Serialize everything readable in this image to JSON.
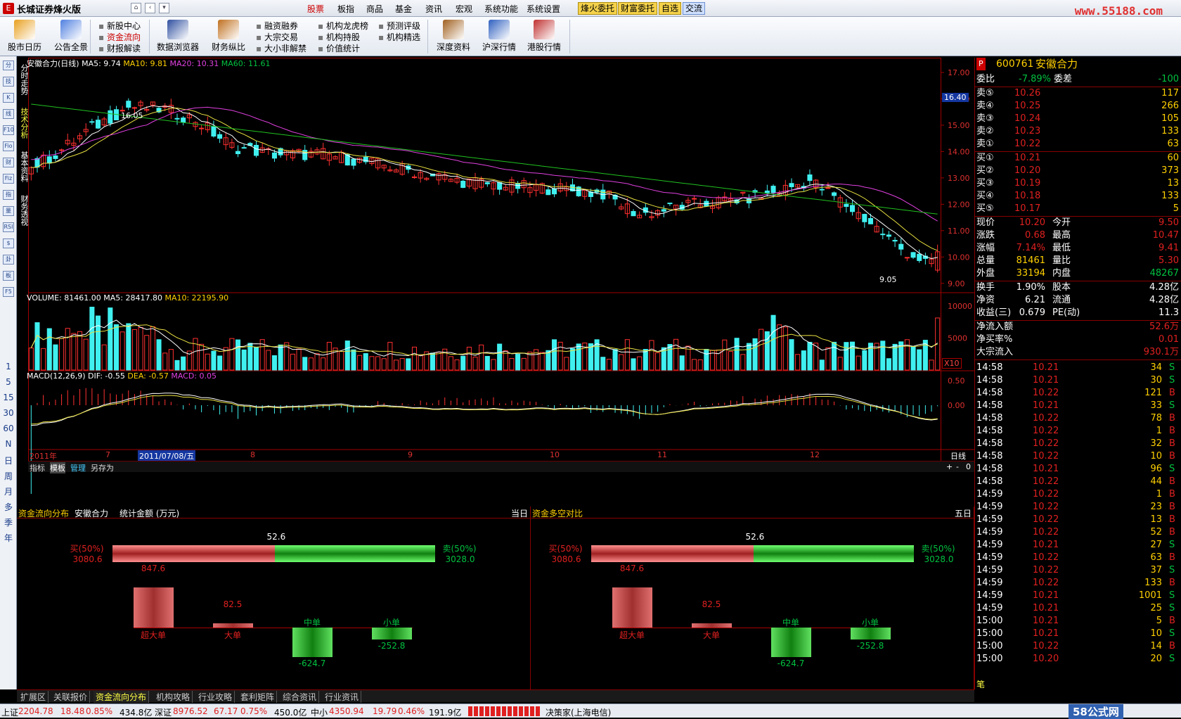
{
  "titlebar": {
    "app": "长城证券烽火版",
    "logo": "E",
    "menus": [
      "股票",
      "板指",
      "商品",
      "基金",
      "资讯",
      "宏观",
      "系统功能",
      "系统设置"
    ],
    "active_menu": "股票",
    "highlights": [
      "烽火委托",
      "财富委托",
      "自选",
      "交流"
    ],
    "site": "www.55188.com"
  },
  "toolbar": {
    "big": [
      "股市日历",
      "公告全景",
      "数据浏览器",
      "财务纵比",
      "深度资料",
      "沪深行情",
      "港股行情"
    ],
    "small_col1": [
      "新股中心",
      "资金流向",
      "财报解读"
    ],
    "small_col2": [
      "融资融券",
      "大宗交易",
      "大小非解禁"
    ],
    "small_col3": [
      "机构龙虎榜",
      "机构持股",
      "价值统计"
    ],
    "small_col4": [
      "预测评级",
      "机构精选"
    ]
  },
  "leftbar": {
    "icons": [
      "分",
      "技",
      "K",
      "线",
      "F10",
      "Fio",
      "财",
      "Fiz",
      "指",
      "量",
      "RSI",
      "$",
      "卦",
      "板",
      "F5"
    ],
    "periods": [
      "1",
      "5",
      "15",
      "30",
      "60",
      "N",
      "日",
      "周",
      "月",
      "多",
      "季",
      "年"
    ]
  },
  "vtabs": [
    "分时走势",
    "技术分析",
    "基本资料",
    "财务透视"
  ],
  "chart_header": {
    "name": "安徽合力(日线)",
    "ma5": "MA5: 9.74",
    "ma10": "MA10: 9.81",
    "ma20": "MA20: 10.31",
    "ma60": "MA60: 11.61",
    "peak": "16.05",
    "low": "9.05",
    "cur_price": "16.40"
  },
  "volume_header": {
    "vol": "VOLUME: 81461.00",
    "ma5": "MA5: 28417.80",
    "ma10": "MA10: 22195.90",
    "x10": "X10"
  },
  "macd_header": {
    "macd": "MACD(12,26,9)",
    "dif": "DIF: -0.55",
    "dea": "DEA: -0.57",
    "val": "MACD: 0.05"
  },
  "price_ticks": [
    "17.00",
    "16.00",
    "15.00",
    "14.00",
    "13.00",
    "12.00",
    "11.00",
    "10.00",
    "9.00"
  ],
  "vol_ticks": [
    "10000",
    "5000"
  ],
  "macd_ticks": [
    "0.50",
    "0.00"
  ],
  "date_axis": {
    "year": "2011年",
    "months": [
      "7",
      "8",
      "9",
      "10",
      "11",
      "12"
    ],
    "cursor": "2011/07/08/五",
    "period": "日线"
  },
  "chart_tabs": [
    "指标",
    "模板",
    "管理",
    "另存为"
  ],
  "right": {
    "code": "600761",
    "name": "安徽合力",
    "flag": "P",
    "weibi": {
      "label": "委比",
      "val": "-7.89%",
      "label2": "委差",
      "val2": "-100"
    },
    "sell": [
      [
        "卖⑤",
        "10.26",
        "117"
      ],
      [
        "卖④",
        "10.25",
        "266"
      ],
      [
        "卖③",
        "10.24",
        "105"
      ],
      [
        "卖②",
        "10.23",
        "133"
      ],
      [
        "卖①",
        "10.22",
        "63"
      ]
    ],
    "buy": [
      [
        "买①",
        "10.21",
        "60"
      ],
      [
        "买②",
        "10.20",
        "373"
      ],
      [
        "买③",
        "10.19",
        "13"
      ],
      [
        "买④",
        "10.18",
        "133"
      ],
      [
        "买⑤",
        "10.17",
        "5"
      ]
    ],
    "quote": [
      [
        "现价",
        "10.20",
        "今开",
        "9.50"
      ],
      [
        "涨跌",
        "0.68",
        "最高",
        "10.47"
      ],
      [
        "涨幅",
        "7.14%",
        "最低",
        "9.41"
      ],
      [
        "总量",
        "81461",
        "量比",
        "5.30"
      ],
      [
        "外盘",
        "33194",
        "内盘",
        "48267"
      ]
    ],
    "fund": [
      [
        "换手",
        "1.90%",
        "股本",
        "4.28亿"
      ],
      [
        "净资",
        "6.21",
        "流通",
        "4.28亿"
      ],
      [
        "收益(三)",
        "0.679",
        "PE(动)",
        "11.3"
      ]
    ],
    "flow": [
      [
        "净流入额",
        "52.6万"
      ],
      [
        "净买率%",
        "0.01"
      ],
      [
        "大宗流入",
        "930.1万"
      ]
    ],
    "ticks": [
      [
        "14:58",
        "10.21",
        "34",
        "S"
      ],
      [
        "14:58",
        "10.21",
        "30",
        "S"
      ],
      [
        "14:58",
        "10.22",
        "121",
        "B"
      ],
      [
        "14:58",
        "10.21",
        "33",
        "S"
      ],
      [
        "14:58",
        "10.22",
        "78",
        "B"
      ],
      [
        "14:58",
        "10.22",
        "1",
        "B"
      ],
      [
        "14:58",
        "10.22",
        "32",
        "B"
      ],
      [
        "14:58",
        "10.22",
        "10",
        "B"
      ],
      [
        "14:58",
        "10.21",
        "96",
        "S"
      ],
      [
        "14:58",
        "10.22",
        "44",
        "B"
      ],
      [
        "14:59",
        "10.22",
        "1",
        "B"
      ],
      [
        "14:59",
        "10.22",
        "23",
        "B"
      ],
      [
        "14:59",
        "10.22",
        "13",
        "B"
      ],
      [
        "14:59",
        "10.22",
        "52",
        "B"
      ],
      [
        "14:59",
        "10.21",
        "27",
        "S"
      ],
      [
        "14:59",
        "10.22",
        "63",
        "B"
      ],
      [
        "14:59",
        "10.22",
        "37",
        "S"
      ],
      [
        "14:59",
        "10.22",
        "133",
        "B"
      ],
      [
        "14:59",
        "10.21",
        "1001",
        "S"
      ],
      [
        "14:59",
        "10.21",
        "25",
        "S"
      ],
      [
        "15:00",
        "10.21",
        "5",
        "B"
      ],
      [
        "15:00",
        "10.21",
        "10",
        "S"
      ],
      [
        "15:00",
        "10.22",
        "14",
        "B"
      ],
      [
        "15:00",
        "10.20",
        "20",
        "S"
      ]
    ],
    "bottom_tab": "笔"
  },
  "bottom": {
    "left": {
      "tab": "资金流向分布",
      "stock": "安徽合力",
      "unit": "统计金额 (万元)",
      "range": "当日"
    },
    "right": {
      "tab": "资金多空对比",
      "range": "五日"
    },
    "net": "52.6",
    "buy_label": "买(50%)",
    "buy_val": "3080.6",
    "sell_label": "卖(50%)",
    "sell_val": "3028.0",
    "buy_frac": 0.504,
    "bars": [
      {
        "name": "超大单",
        "val": "847.6",
        "n": 847.6
      },
      {
        "name": "大单",
        "val": "82.5",
        "n": 82.5
      },
      {
        "name": "中单",
        "val": "-624.7",
        "n": -624.7
      },
      {
        "name": "小单",
        "val": "-252.8",
        "n": -252.8
      }
    ]
  },
  "bottom_tabs": [
    "扩展区",
    "关联报价",
    "资金流向分布",
    "机构攻略",
    "行业攻略",
    "套利矩阵",
    "综合资讯",
    "行业资讯"
  ],
  "bottom_active": "资金流向分布",
  "status": {
    "sh": "上证",
    "sh_idx": "2204.78",
    "sh_chg": "18.48",
    "sh_pct": "0.85%",
    "sh_amt": "434.8亿",
    "sz": "深证",
    "sz_idx": "8976.52",
    "sz_chg": "67.17",
    "sz_pct": "0.75%",
    "sz_amt": "450.0亿",
    "zx": "中小",
    "zx_idx": "4350.94",
    "zx_chg": "19.79",
    "zx_pct": "0.46%",
    "zx_amt": "191.9亿",
    "server": "决策家(上海电信)",
    "watermark": "58公式网"
  },
  "colors": {
    "up": "#ff3030",
    "down": "#40f0f0",
    "ma5": "#ffffff",
    "ma10": "#e8e040",
    "ma20": "#e040e0",
    "ma60": "#20c020",
    "frame": "#a00000"
  }
}
